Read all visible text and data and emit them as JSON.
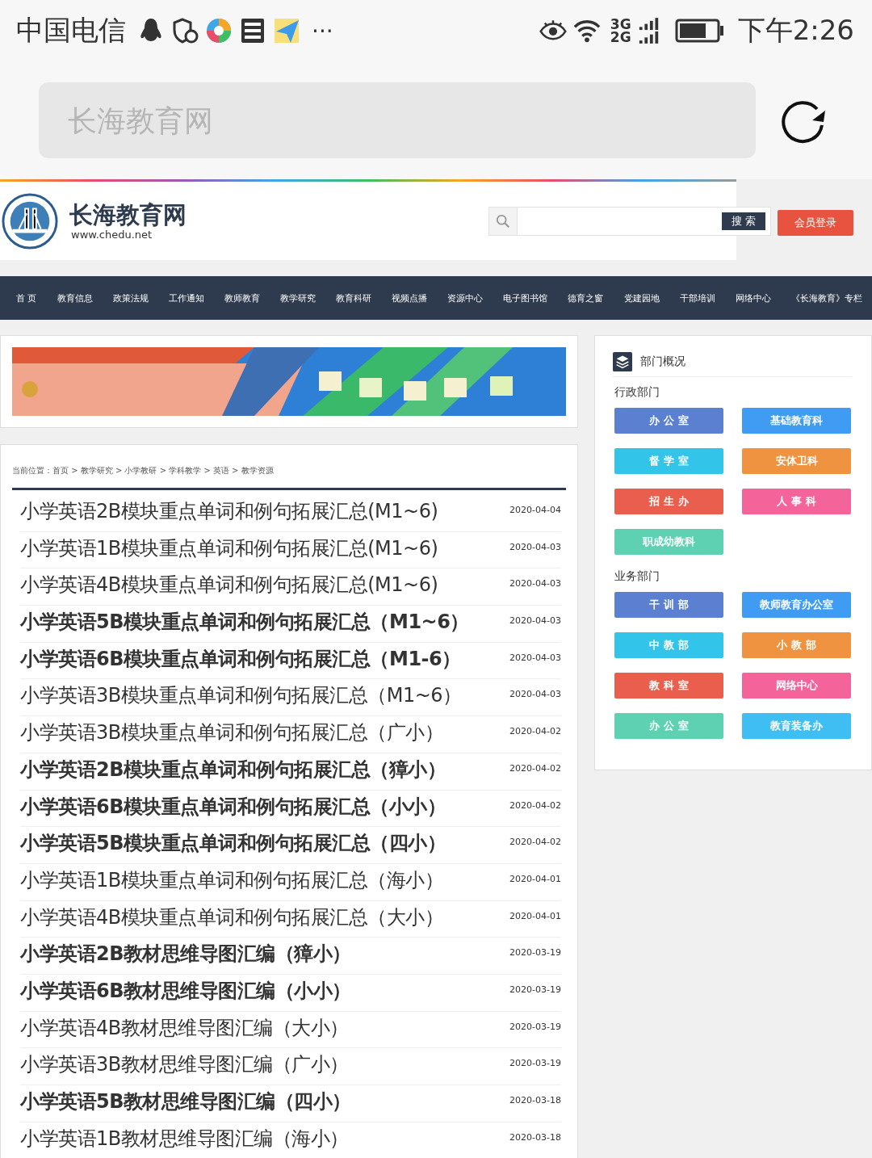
{
  "status_bar": {
    "carrier": "中国电信",
    "more": "···",
    "net_top": "3G",
    "net_bottom": "2G",
    "time": "下午2:26"
  },
  "address_bar": {
    "placeholder": "长海教育网"
  },
  "site_header": {
    "title": "长海教育网",
    "url": "www.chedu.net",
    "search_button": "搜 索",
    "login_button": "会员登录"
  },
  "nav": [
    {
      "label": "首 页"
    },
    {
      "label": "教育信息"
    },
    {
      "label": "政策法规"
    },
    {
      "label": "工作通知"
    },
    {
      "label": "教师教育"
    },
    {
      "label": "教学研究"
    },
    {
      "label": "教育科研"
    },
    {
      "label": "视频点播"
    },
    {
      "label": "资源中心"
    },
    {
      "label": "电子图书馆"
    },
    {
      "label": "德育之窗"
    },
    {
      "label": "党建园地"
    },
    {
      "label": "干部培训"
    },
    {
      "label": "网络中心"
    },
    {
      "label": "《长海教育》专栏"
    }
  ],
  "breadcrumb": "当前位置：首页 > 教学研究 > 小学教研 > 学科教学 > 英语 > 教学资源",
  "articles": [
    {
      "title": "小学英语2B模块重点单词和例句拓展汇总(M1~6)",
      "date": "2020-04-04",
      "bold": false
    },
    {
      "title": "小学英语1B模块重点单词和例句拓展汇总(M1~6)",
      "date": "2020-04-03",
      "bold": false
    },
    {
      "title": "小学英语4B模块重点单词和例句拓展汇总(M1~6)",
      "date": "2020-04-03",
      "bold": false
    },
    {
      "title": "小学英语5B模块重点单词和例句拓展汇总（M1~6）",
      "date": "2020-04-03",
      "bold": true
    },
    {
      "title": "小学英语6B模块重点单词和例句拓展汇总（M1-6）",
      "date": "2020-04-03",
      "bold": true
    },
    {
      "title": "小学英语3B模块重点单词和例句拓展汇总（M1~6）",
      "date": "2020-04-03",
      "bold": false
    },
    {
      "title": "小学英语3B模块重点单词和例句拓展汇总（广小）",
      "date": "2020-04-02",
      "bold": false
    },
    {
      "title": "小学英语2B模块重点单词和例句拓展汇总（獐小）",
      "date": "2020-04-02",
      "bold": true
    },
    {
      "title": "小学英语6B模块重点单词和例句拓展汇总（小小）",
      "date": "2020-04-02",
      "bold": true
    },
    {
      "title": "小学英语5B模块重点单词和例句拓展汇总（四小）",
      "date": "2020-04-02",
      "bold": true
    },
    {
      "title": "小学英语1B模块重点单词和例句拓展汇总（海小）",
      "date": "2020-04-01",
      "bold": false
    },
    {
      "title": "小学英语4B模块重点单词和例句拓展汇总（大小）",
      "date": "2020-04-01",
      "bold": false
    },
    {
      "title": "小学英语2B教材思维导图汇编（獐小）",
      "date": "2020-03-19",
      "bold": true
    },
    {
      "title": "小学英语6B教材思维导图汇编（小小）",
      "date": "2020-03-19",
      "bold": true
    },
    {
      "title": "小学英语4B教材思维导图汇编（大小）",
      "date": "2020-03-19",
      "bold": false
    },
    {
      "title": "小学英语3B教材思维导图汇编（广小）",
      "date": "2020-03-19",
      "bold": false
    },
    {
      "title": "小学英语5B教材思维导图汇编（四小）",
      "date": "2020-03-18",
      "bold": true
    },
    {
      "title": "小学英语1B教材思维导图汇编（海小）",
      "date": "2020-03-18",
      "bold": false
    }
  ],
  "departments": {
    "title": "部门概况",
    "sections": [
      {
        "label": "行政部门",
        "buttons": [
          {
            "label": "办 公 室",
            "color": "#5b7fd1"
          },
          {
            "label": "基础教育科",
            "color": "#409cf3"
          },
          {
            "label": "督 学 室",
            "color": "#32c5e9"
          },
          {
            "label": "安体卫科",
            "color": "#f09340"
          },
          {
            "label": "招 生 办",
            "color": "#ea5e4e"
          },
          {
            "label": "人 事 科",
            "color": "#f4649a"
          },
          {
            "label": "职成幼教科",
            "color": "#5dd1b2"
          }
        ]
      },
      {
        "label": "业务部门",
        "buttons": [
          {
            "label": "干 训 部",
            "color": "#5b7fd1"
          },
          {
            "label": "教师教育办公室",
            "color": "#409cf3"
          },
          {
            "label": "中 教 部",
            "color": "#32c5e9"
          },
          {
            "label": "小 教 部",
            "color": "#f09340"
          },
          {
            "label": "教 科 室",
            "color": "#ea5e4e"
          },
          {
            "label": "网络中心",
            "color": "#f4649a"
          },
          {
            "label": "办 公 室",
            "color": "#5dd1b2"
          },
          {
            "label": "教育装备办",
            "color": "#3ebef2"
          }
        ]
      }
    ]
  }
}
